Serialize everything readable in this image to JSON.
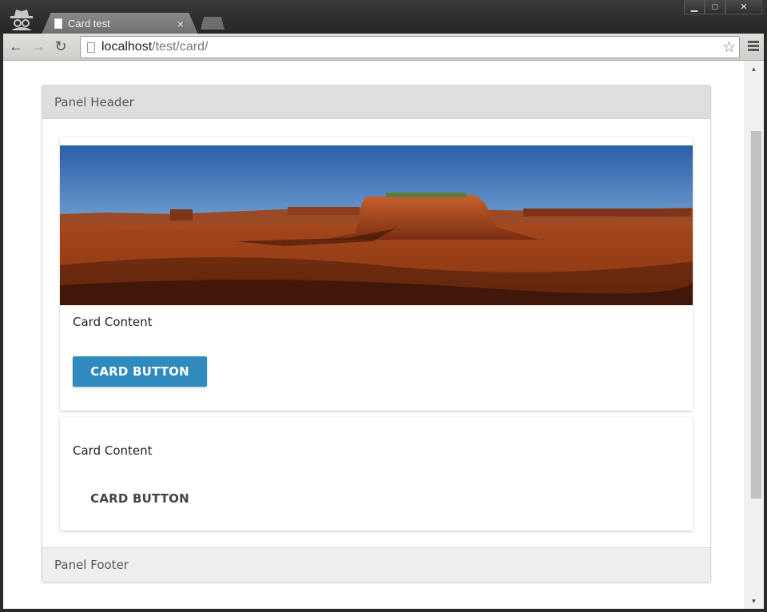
{
  "window": {
    "tab_title": "Card test",
    "tab_close": "×",
    "buttons": {
      "minimize": "▁",
      "maximize": "□",
      "close": "✕"
    }
  },
  "toolbar": {
    "back": "←",
    "forward": "→",
    "reload": "↻",
    "url_host": "localhost",
    "url_path": "/test/card/",
    "star": "☆"
  },
  "scrollbar": {
    "up": "▲",
    "down": "▼"
  },
  "panel": {
    "header": "Panel Header",
    "footer": "Panel Footer"
  },
  "cards": [
    {
      "content": "Card Content",
      "button": "CARD BUTTON",
      "button_style": "raised"
    },
    {
      "content": "Card Content",
      "button": "CARD BUTTON",
      "button_style": "flat"
    }
  ],
  "colors": {
    "accent_button": "#2f8bbd",
    "panel_header_bg": "#dedede",
    "panel_footer_bg": "#efefef"
  },
  "icons": [
    "incognito-icon",
    "page-icon",
    "back-arrow-icon",
    "forward-arrow-icon",
    "reload-icon",
    "star-icon",
    "menu-icon"
  ]
}
